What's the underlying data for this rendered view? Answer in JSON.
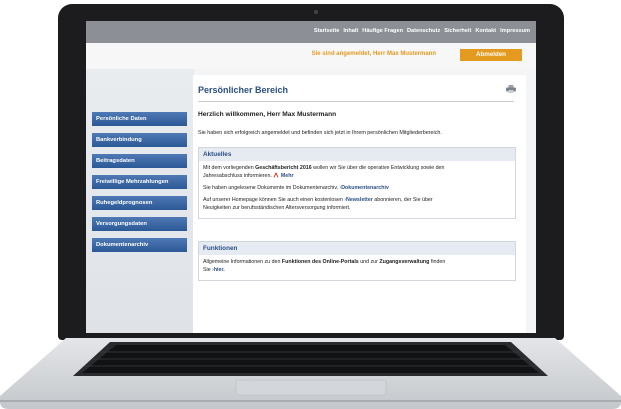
{
  "topnav": [
    "Startseite",
    "Inhalt",
    "Häufige Fragen",
    "Datenschutz",
    "Sicherheit",
    "Kontakt",
    "Impressum"
  ],
  "login": {
    "status": "Sie sind angemeldet, Herr Max Mustermann",
    "logout_label": "Abmelden"
  },
  "sidebar": {
    "items": [
      {
        "label": "Persönliche Daten"
      },
      {
        "label": "Bankverbindung"
      },
      {
        "label": "Beitragsdaten"
      },
      {
        "label": "Freiwillige Mehrzahlungen"
      },
      {
        "label": "Ruhegeldprognosen"
      },
      {
        "label": "Versorgungsdaten"
      },
      {
        "label": "Dokumentenarchiv"
      }
    ]
  },
  "main": {
    "title": "Persönlicher Bereich",
    "greeting": "Herzlich willkommen, Herr Max Mustermann",
    "intro": "Sie haben sich erfolgreich angemeldet und befinden sich jetzt in Ihrem persönlichen Mitgliederbereich.",
    "aktuelles": {
      "heading": "Aktuelles",
      "p1_a": "Mit dem vorliegenden ",
      "p1_b": "Geschäftsbericht 2016",
      "p1_c": " wollen wir Sie über die operative Entwicklung sowie den",
      "p1_d": "Jahresabschluss informieren.",
      "p1_link": "Mehr",
      "p2_a": "Sie haben ungelesene Dokumente im Dokumentenarchiv.",
      "p2_link": "Dokumentenarchiv",
      "p3_a": "Auf unserer Homepage können Sie auch einen kostenlosen",
      "p3_link": "Newsletter",
      "p3_b": " abonnieren, der Sie über",
      "p3_c": "Neuigkeiten zur berufsständischen Altersversorgung informiert."
    },
    "funktionen": {
      "heading": "Funktionen",
      "p1_a": "Allgemeine Informationen zu den ",
      "p1_b": "Funktionen des Online-Portals",
      "p1_c": " und zur ",
      "p1_d": "Zugangsverwaltung",
      "p1_e": " finden",
      "p1_f": "Sie",
      "p1_link": "hier."
    }
  },
  "colors": {
    "accent_orange": "#e39a1e",
    "nav_blue": "#2b5897",
    "title_blue": "#2a4f86",
    "topbar_gray": "#8c9096"
  },
  "icons": [
    "printer-icon",
    "pdf-icon",
    "arrow-right-icon"
  ]
}
